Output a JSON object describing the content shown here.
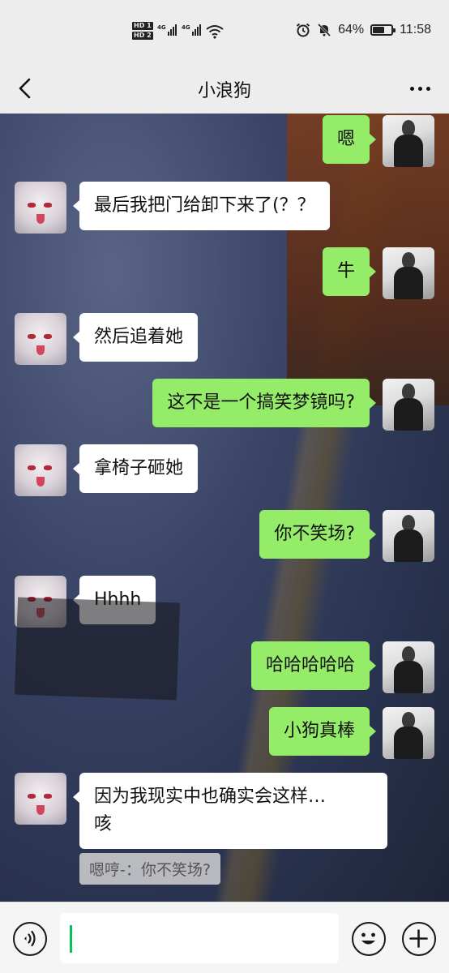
{
  "status": {
    "sim": [
      "HD 1",
      "HD 2"
    ],
    "network": [
      "4G",
      "4G"
    ],
    "battery_percent": "64%",
    "battery_level": 0.64,
    "time": "11:58"
  },
  "header": {
    "title": "小浪狗"
  },
  "messages": [
    {
      "side": "right",
      "text": "嗯"
    },
    {
      "side": "left",
      "text": "最后我把门给卸下来了(？？"
    },
    {
      "side": "right",
      "text": "牛"
    },
    {
      "side": "left",
      "text": "然后追着她"
    },
    {
      "side": "right",
      "text": "这不是一个搞笑梦镜吗?"
    },
    {
      "side": "left",
      "text": "拿椅子砸她"
    },
    {
      "side": "right",
      "text": "你不笑场?"
    },
    {
      "side": "left",
      "text": "Hhhh"
    },
    {
      "side": "right",
      "text": "哈哈哈哈哈"
    },
    {
      "side": "right",
      "text": "小狗真棒"
    },
    {
      "side": "left",
      "text": "因为我现实中也确实会这样…\n咳"
    }
  ],
  "quote": {
    "text": "嗯哼-：你不笑场?"
  },
  "input": {
    "value": ""
  },
  "colors": {
    "accent": "#07c160",
    "bubble_right": "#95ec69",
    "bubble_left": "#ffffff"
  },
  "icons": {
    "back": "chevron-left-icon",
    "more": "more-dots-icon",
    "voice": "voice-icon",
    "emoji": "emoji-icon",
    "plus": "plus-icon"
  }
}
